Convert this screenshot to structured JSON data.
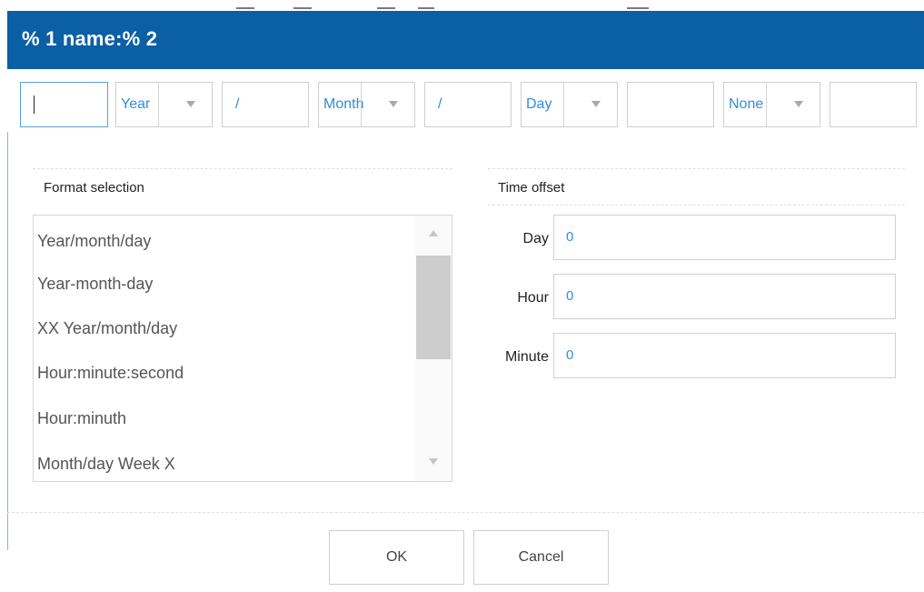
{
  "dialog": {
    "title": "% 1 name:% 2"
  },
  "format_row": {
    "prefix_value": "",
    "year_select": "Year",
    "separator1": "/",
    "month_select": "Month",
    "separator2": "/",
    "day_select": "Day",
    "middle_value": "",
    "time_select": "None",
    "suffix_value": ""
  },
  "format_selection": {
    "title": "Format selection",
    "items": [
      "Year/month/day",
      "Year-month-day",
      "XX Year/month/day",
      "Hour:minute:second",
      "Hour:minuth",
      "Month/day Week X"
    ]
  },
  "time_offset": {
    "title": "Time offset",
    "day_label": "Day",
    "day_value": "0",
    "hour_label": "Hour",
    "hour_value": "0",
    "minute_label": "Minute",
    "minute_value": "0"
  },
  "buttons": {
    "ok": "OK",
    "cancel": "Cancel"
  },
  "colors": {
    "title_bar": "#0b5fa5",
    "accent_text": "#2f8fd6"
  },
  "icons": {
    "dropdown": "chevron-down-icon",
    "scroll_up": "triangle-up-icon",
    "scroll_down": "triangle-down-icon"
  }
}
